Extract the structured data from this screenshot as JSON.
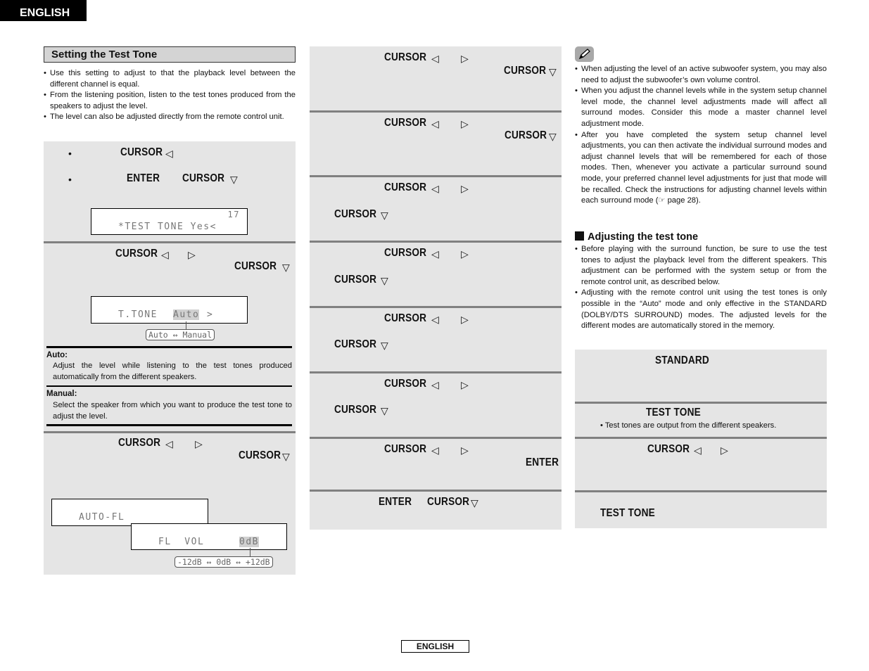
{
  "header": {
    "language_tab": "ENGLISH"
  },
  "footer": {
    "language_label": "ENGLISH"
  },
  "left": {
    "title": "Setting the Test Tone",
    "intro_bullets": [
      "Use this setting to adjust to that the playback level between the different channel is equal.",
      "From the listening position, listen to the test tones produced from the speakers to adjust the level.",
      "The level can also be adjusted directly from the remote control unit."
    ],
    "step1": {
      "line1_key": "CURSOR",
      "line2_key1": "ENTER",
      "line2_key2": "CURSOR",
      "display_line1": "17",
      "display_line2": "*TEST TONE Yes<"
    },
    "step2": {
      "key1": "CURSOR",
      "key2": "CURSOR",
      "display_label": "T.TONE",
      "display_value": "Auto",
      "display_suffix": ">",
      "options_left": "Auto",
      "options_right": "Manual"
    },
    "definitions": [
      {
        "term": "Auto:",
        "text": "Adjust the level while listening to the test tones produced automatically from the different speakers."
      },
      {
        "term": "Manual:",
        "text": "Select the speaker from which you want to produce the test tone to adjust the level."
      }
    ],
    "step3": {
      "key1": "CURSOR",
      "key2": "CURSOR",
      "display_a": "AUTO-FL",
      "display_b_label": "FL  VOL",
      "display_b_value": "0dB",
      "range_min": "-12dB",
      "range_mid": "0dB",
      "range_max": "+12dB"
    }
  },
  "middle": {
    "steps": [
      {
        "key1": "CURSOR",
        "key2": "CURSOR"
      },
      {
        "key1": "CURSOR",
        "key2": "CURSOR"
      },
      {
        "key1": "CURSOR",
        "key2": "CURSOR"
      },
      {
        "key1": "CURSOR",
        "key2": "CURSOR"
      },
      {
        "key1": "CURSOR",
        "key2": "CURSOR"
      },
      {
        "key1": "CURSOR",
        "key2": "CURSOR"
      },
      {
        "key1": "CURSOR",
        "key2": "ENTER"
      },
      {
        "key1": "ENTER",
        "key2": "CURSOR"
      }
    ]
  },
  "right": {
    "note_icon": "pencil-icon",
    "notes": [
      "When adjusting the level of an active subwoofer system, you may also need to adjust the subwoofer’s own volume control.",
      "When you adjust the channel levels while in the system setup channel level mode, the channel level adjustments made will affect all surround modes. Consider this mode a master channel level adjustment mode.",
      "After you have completed the system setup channel level adjustments, you can then activate the individual surround modes and adjust channel levels that will be remembered for each of those modes. Then, whenever you activate a particular surround sound mode, your preferred channel level adjustments for just that mode will be recalled. Check the instructions for adjusting channel levels within each surround mode (☞ page 28)."
    ],
    "subheading": "Adjusting the test tone",
    "sub_bullets": [
      "Before playing with the surround function, be sure to use the test tones to adjust the playback level from the different speakers. This adjustment can be performed with the system setup or from the remote control unit, as described below.",
      "Adjusting with the remote control unit using the test tones is only possible in the “Auto” mode and only effective in the STANDARD (DOLBY/DTS SURROUND) modes. The adjusted levels for the different modes are automatically stored in the memory."
    ],
    "steps": {
      "s1_key": "STANDARD",
      "s2_key": "TEST TONE",
      "s2_note": "• Test tones are output from the different speakers.",
      "s3_key": "CURSOR",
      "s4_key": "TEST TONE"
    }
  }
}
